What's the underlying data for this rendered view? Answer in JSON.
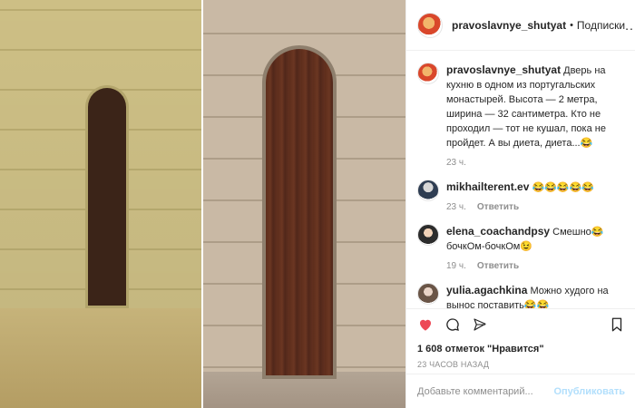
{
  "header": {
    "username": "pravoslavnye_shutyat",
    "separator": "•",
    "subscribe_label": "Подписки",
    "more_label": "..."
  },
  "caption": {
    "username": "pravoslavnye_shutyat",
    "text": "Дверь на кухню в одном из португальских монастырей. Высота — 2 метра, ширина — 32 сантиметра. Кто не проходил — тот не кушал, пока не пройдет. А вы диета, диета...😂",
    "time": "23 ч."
  },
  "comments": [
    {
      "username": "mikhailterent.ev",
      "text": "😂😂😂😂😂",
      "time": "23 ч.",
      "reply_label": "Ответить"
    },
    {
      "username": "elena_coachandpsy",
      "text": "Смешно😂 бочкОм-бочкОм😉",
      "time": "19 ч.",
      "reply_label": "Ответить"
    },
    {
      "username": "yulia.agachkina",
      "text": "Можно худого на вынос поставить😂😂",
      "time": "",
      "reply_label": ""
    }
  ],
  "actions": {
    "likes": "1 608 отметок \"Нравится\"",
    "timestamp": "23 ЧАСОВ НАЗАД"
  },
  "comment_box": {
    "placeholder": "Добавьте комментарий...",
    "publish_label": "Опубликовать"
  },
  "colors": {
    "like": "#ed4956",
    "publish_disabled": "#b2dffc",
    "muted": "#8e8e8e"
  }
}
